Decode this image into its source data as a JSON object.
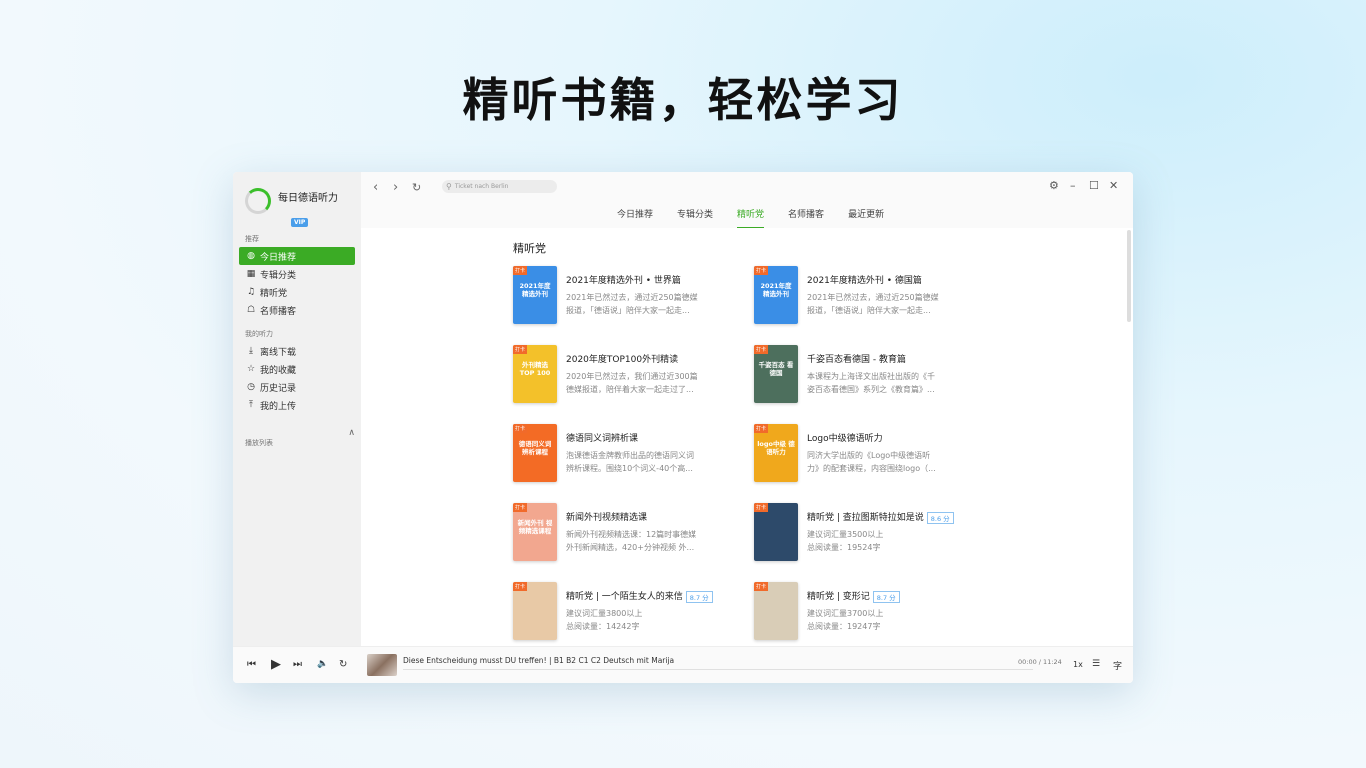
{
  "hero": {
    "title": "精听书籍，轻松学习"
  },
  "app": {
    "name": "每日德语听力",
    "vip": "VIP"
  },
  "sidebar": {
    "section_recommend": "推荐",
    "recommend_items": [
      {
        "label": "今日推荐",
        "icon": "compass-icon",
        "glyph": "◍",
        "active": true
      },
      {
        "label": "专辑分类",
        "icon": "grid-icon",
        "glyph": "▦",
        "active": false
      },
      {
        "label": "精听党",
        "icon": "headphones-icon",
        "glyph": "♫",
        "active": false
      },
      {
        "label": "名师播客",
        "icon": "podcast-icon",
        "glyph": "☖",
        "active": false
      }
    ],
    "section_mine": "我的听力",
    "mine_items": [
      {
        "label": "离线下载",
        "icon": "download-icon",
        "glyph": "⤓"
      },
      {
        "label": "我的收藏",
        "icon": "star-icon",
        "glyph": "☆"
      },
      {
        "label": "历史记录",
        "icon": "clock-icon",
        "glyph": "◷"
      },
      {
        "label": "我的上传",
        "icon": "upload-icon",
        "glyph": "⤒"
      }
    ],
    "playlist_label": "播放列表",
    "playlist_toggle": "∧"
  },
  "toolbar": {
    "back": "‹",
    "forward": "›",
    "refresh": "↻",
    "search_placeholder": "Ticket nach Berlin",
    "settings": "⚙",
    "minimize": "–",
    "maximize": "☐",
    "close": "✕"
  },
  "tabs": [
    {
      "label": "今日推荐",
      "active": false
    },
    {
      "label": "专辑分类",
      "active": false
    },
    {
      "label": "精听党",
      "active": true
    },
    {
      "label": "名师播客",
      "active": false
    },
    {
      "label": "最近更新",
      "active": false
    }
  ],
  "content": {
    "section_title": "精听党",
    "cards": [
      {
        "title": "2021年度精选外刊 • 世界篇",
        "rating": "",
        "desc1": "2021年已然过去，通过近250篇德媒",
        "desc2": "报道，「德语说」陪伴大家一起走...",
        "cover_tag": "打卡",
        "cover_text": "2021年度 精选外刊",
        "cover_color": "#3a8ee6"
      },
      {
        "title": "2021年度精选外刊 • 德国篇",
        "rating": "",
        "desc1": "2021年已然过去，通过近250篇德媒",
        "desc2": "报道，「德语说」陪伴大家一起走...",
        "cover_tag": "打卡",
        "cover_text": "2021年度 精选外刊",
        "cover_color": "#3a8ee6"
      },
      {
        "title": "2020年度TOP100外刊精读",
        "rating": "",
        "desc1": "2020年已然过去，我们通过近300篇",
        "desc2": "德媒报道，陪伴着大家一起走过了...",
        "cover_tag": "打卡",
        "cover_text": "外刊精选 TOP 100",
        "cover_color": "#f3c12a"
      },
      {
        "title": "千姿百态看德国 - 教育篇",
        "rating": "",
        "desc1": "本课程为上海译文出版社出版的《千",
        "desc2": "姿百态看德国》系列之《教育篇》...",
        "cover_tag": "打卡",
        "cover_text": "千姿百态 看德国",
        "cover_color": "#4d6f5d"
      },
      {
        "title": "德语同义词辨析课",
        "rating": "",
        "desc1": "泡课德语金牌教师出品的德语同义词",
        "desc2": "辨析课程。围绕10个词义-40个高...",
        "cover_tag": "打卡",
        "cover_text": "德语同义词 辨析课程",
        "cover_color": "#f36b25"
      },
      {
        "title": "Logo中级德语听力",
        "rating": "",
        "desc1": "同济大学出版的《Logo中级德语听",
        "desc2": "力》的配套课程，内容围绕logo（...",
        "cover_tag": "打卡",
        "cover_text": "logo中级 德语听力",
        "cover_color": "#f0a81c"
      },
      {
        "title": "新闻外刊视频精选课",
        "rating": "",
        "desc1": "新闻外刊视频精选课：12篇时事德媒",
        "desc2": "外刊新闻精选，420+分钟视频 外...",
        "cover_tag": "打卡",
        "cover_text": "新闻外刊 视频精选课程",
        "cover_color": "#f2a78f"
      },
      {
        "title": "精听党 | 查拉图斯特拉如是说",
        "rating": "8.6 分",
        "desc1": "建议词汇量3500以上",
        "desc2": "总阅读量：19524字",
        "cover_tag": "打卡",
        "cover_text": "",
        "cover_color": "#2d4a6a"
      },
      {
        "title": "精听党 | 一个陌生女人的来信",
        "rating": "8.7 分",
        "desc1": "建议词汇量3800以上",
        "desc2": "总阅读量：14242字",
        "cover_tag": "打卡",
        "cover_text": "",
        "cover_color": "#e8c9a6"
      },
      {
        "title": "精听党 | 变形记",
        "rating": "8.7 分",
        "desc1": "建议词汇量3700以上",
        "desc2": "总阅读量：19247字",
        "cover_tag": "打卡",
        "cover_text": "",
        "cover_color": "#d9cdb7"
      }
    ]
  },
  "player": {
    "prev": "⏮",
    "play": "▶",
    "next": "⏭",
    "volume": "🔈",
    "loop": "↻",
    "track": "Diese Entscheidung musst DU treffen! | B1 B2 C1 C2 Deutsch mit Marija",
    "time": "00:00 / 11:24",
    "speed": "1x",
    "list": "☰",
    "subtitle": "字"
  }
}
